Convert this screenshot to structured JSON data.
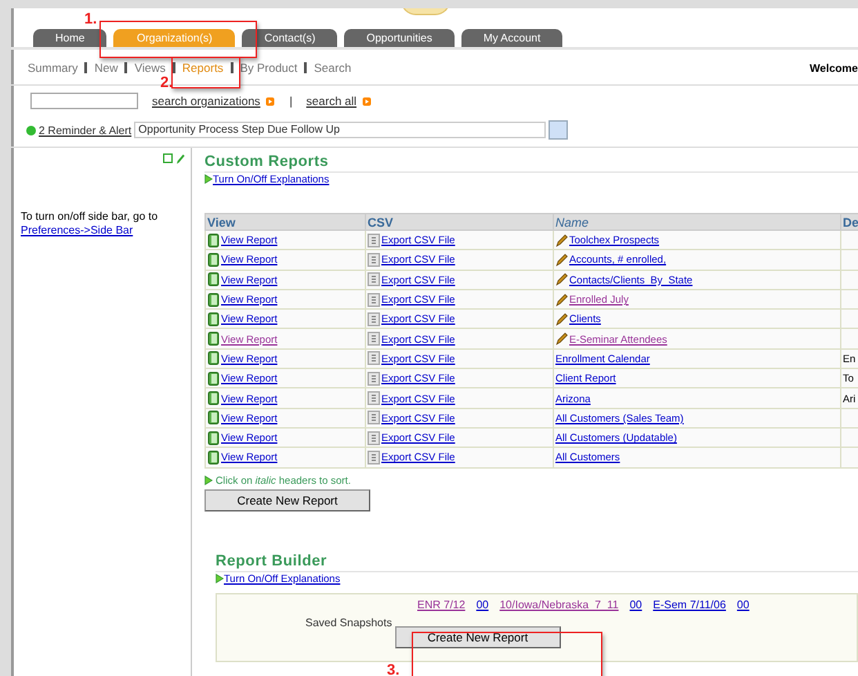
{
  "tabs": [
    {
      "label": "Home",
      "selected": false
    },
    {
      "label": "Organization(s)",
      "selected": true
    },
    {
      "label": "Contact(s)",
      "selected": false
    },
    {
      "label": "Opportunities",
      "selected": false
    },
    {
      "label": "My Account",
      "selected": false
    }
  ],
  "subnav": [
    {
      "label": "Summary",
      "selected": false
    },
    {
      "label": "New",
      "selected": false
    },
    {
      "label": "Views",
      "selected": false
    },
    {
      "label": "Reports",
      "selected": true
    },
    {
      "label": "By Product",
      "selected": false
    },
    {
      "label": "Search",
      "selected": false
    }
  ],
  "welcome": "Welcome",
  "search": {
    "links": [
      "search organizations",
      "search all"
    ],
    "separator": "|"
  },
  "alert": {
    "link": "2 Reminder & Alert",
    "value": "Opportunity Process Step Due Follow Up"
  },
  "sidebar": {
    "text": "To turn on/off side bar, go to",
    "link": "Preferences->Side Bar"
  },
  "custom_reports": {
    "title": "Custom Reports",
    "explanations": "Turn On/Off Explanations",
    "columns": [
      "View",
      "CSV",
      "Name",
      "De"
    ],
    "rows": [
      {
        "view": "View Report",
        "view_visited": false,
        "csv": "Export CSV File",
        "name": "Toolchex Prospects",
        "name_visited": false,
        "editable": true
      },
      {
        "view": "View Report",
        "view_visited": false,
        "csv": "Export CSV File",
        "name": "Accounts, # enrolled,",
        "name_visited": false,
        "editable": true
      },
      {
        "view": "View Report",
        "view_visited": false,
        "csv": "Export CSV File",
        "name": "Contacts/Clients_By_State",
        "name_visited": false,
        "editable": true
      },
      {
        "view": "View Report",
        "view_visited": false,
        "csv": "Export CSV File",
        "name": "Enrolled July",
        "name_visited": true,
        "editable": true
      },
      {
        "view": "View Report",
        "view_visited": false,
        "csv": "Export CSV File",
        "name": "Clients",
        "name_visited": false,
        "editable": true
      },
      {
        "view": "View Report",
        "view_visited": true,
        "csv": "Export CSV File",
        "name": "E-Seminar Attendees",
        "name_visited": true,
        "editable": true
      },
      {
        "view": "View Report",
        "view_visited": false,
        "csv": "Export CSV File",
        "name": "Enrollment Calendar",
        "name_visited": false,
        "editable": false,
        "column_4": "En"
      },
      {
        "view": "View Report",
        "view_visited": false,
        "csv": "Export CSV File",
        "name": "Client Report",
        "name_visited": false,
        "editable": false,
        "column_4": "To"
      },
      {
        "view": "View Report",
        "view_visited": false,
        "csv": "Export CSV File",
        "name": "Arizona",
        "name_visited": false,
        "editable": false,
        "column_4": "Ari"
      },
      {
        "view": "View Report",
        "view_visited": false,
        "csv": "Export CSV File",
        "name": "All Customers (Sales Team)",
        "name_visited": false,
        "editable": false
      },
      {
        "view": "View Report",
        "view_visited": false,
        "csv": "Export CSV File",
        "name": "All Customers (Updatable)",
        "name_visited": false,
        "editable": false
      },
      {
        "view": "View Report",
        "view_visited": false,
        "csv": "Export CSV File",
        "name": "All Customers",
        "name_visited": false,
        "editable": false
      }
    ],
    "sort_hint": "Click on *italic* headers to sort.",
    "button": "Create New Report"
  },
  "report_builder": {
    "title": "Report Builder",
    "explanations": "Turn On/Off Explanations",
    "snapshots": [
      {
        "label": "ENR 7/12",
        "visited": true,
        "count": "00"
      },
      {
        "label": "10/Iowa/Nebraska_7_11",
        "visited": true,
        "count": "00"
      },
      {
        "label": "E-Sem 7/11/06",
        "visited": false,
        "count": "00"
      }
    ],
    "snapshots_label": "Saved Snapshots",
    "button": "Create New Report"
  },
  "annotations": [
    {
      "label": "1."
    },
    {
      "label": "2."
    },
    {
      "label": "3."
    }
  ]
}
